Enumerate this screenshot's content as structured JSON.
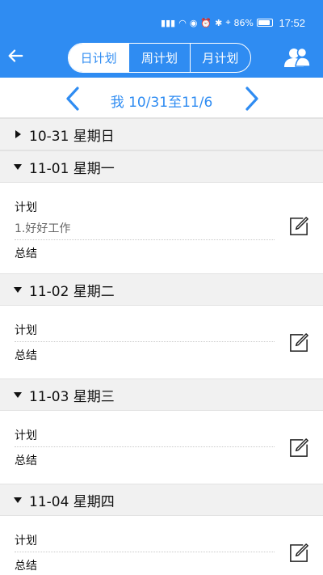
{
  "status": {
    "battery": "86%",
    "time": "17:52"
  },
  "header": {
    "tabs": [
      "日计划",
      "周计划",
      "月计划"
    ]
  },
  "datenav": {
    "range": "我 10/31至11/6"
  },
  "days": [
    {
      "title": "10-31 星期日"
    },
    {
      "title": "11-01 星期一",
      "plan_label": "计划",
      "plan_entry": "1.好好工作",
      "summary_label": "总结"
    },
    {
      "title": "11-02 星期二",
      "plan_label": "计划",
      "summary_label": "总结"
    },
    {
      "title": "11-03 星期三",
      "plan_label": "计划",
      "summary_label": "总结"
    },
    {
      "title": "11-04 星期四",
      "plan_label": "计划",
      "summary_label": "总结"
    }
  ],
  "colors": {
    "accent": "#2f8cf2",
    "header_bg": "#f1f1f1"
  }
}
